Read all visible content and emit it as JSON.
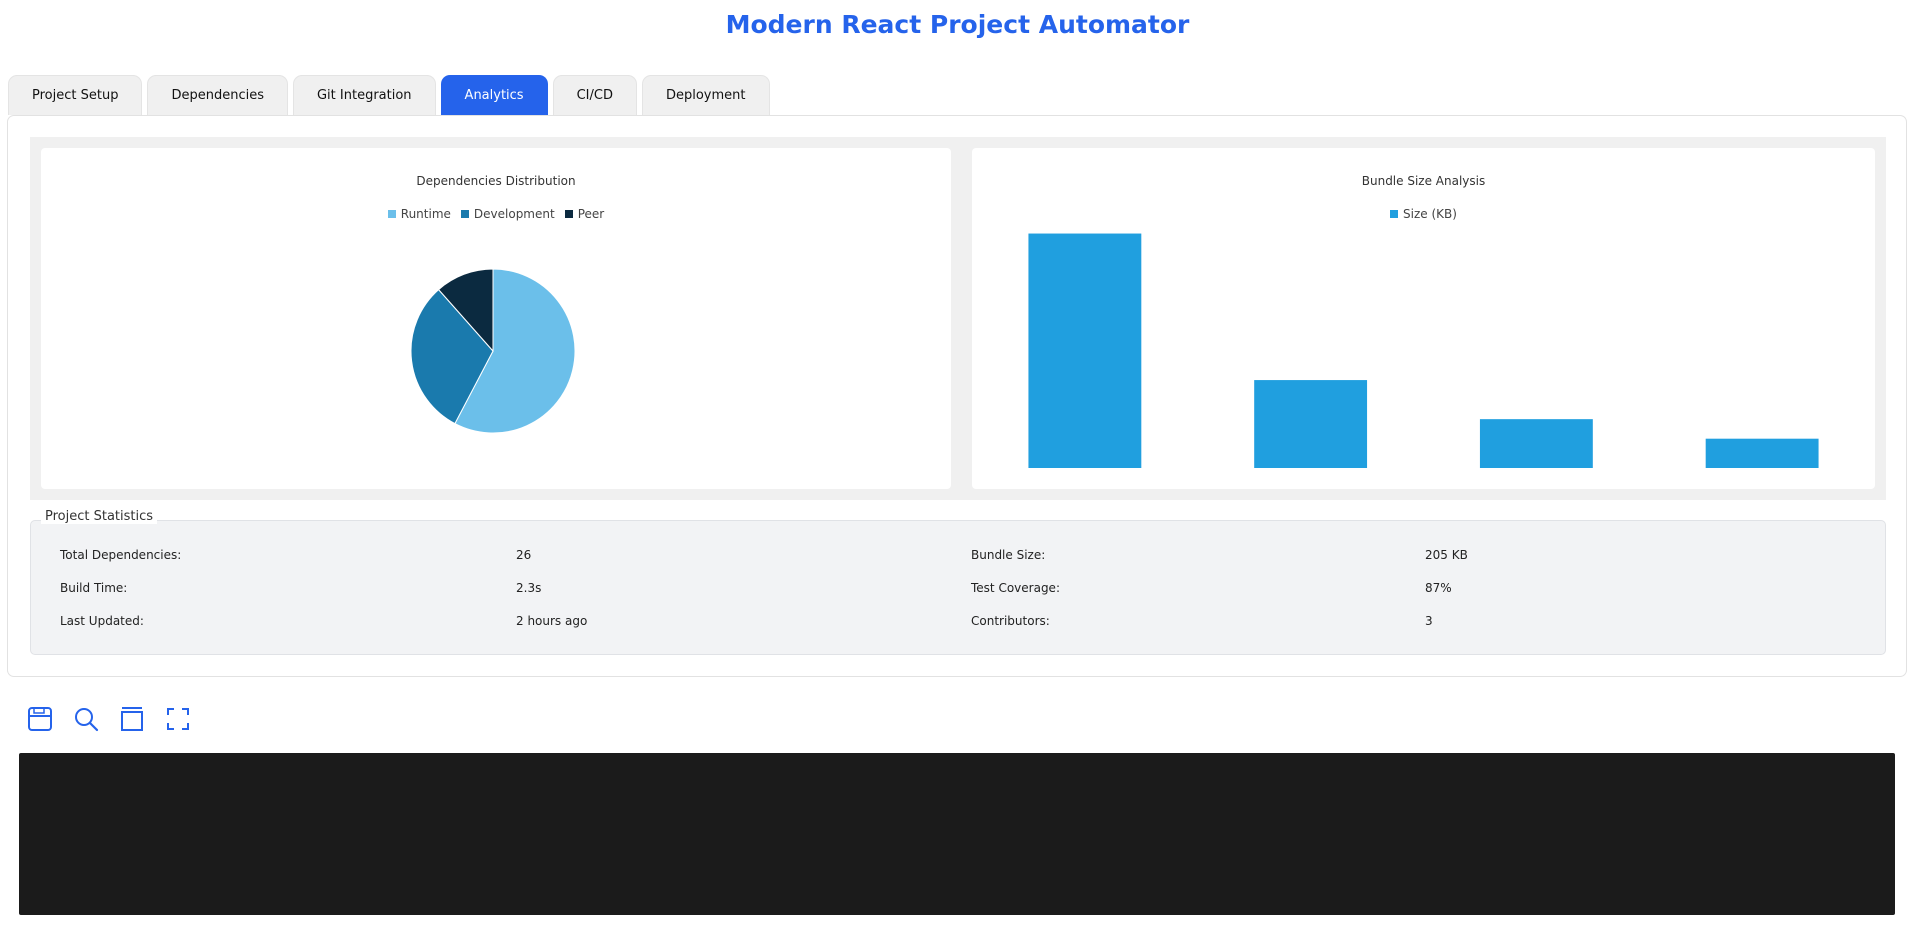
{
  "app": {
    "title": "Modern React Project Automator"
  },
  "tabs": [
    {
      "label": "Project Setup",
      "active": false
    },
    {
      "label": "Dependencies",
      "active": false
    },
    {
      "label": "Git Integration",
      "active": false
    },
    {
      "label": "Analytics",
      "active": true
    },
    {
      "label": "CI/CD",
      "active": false
    },
    {
      "label": "Deployment",
      "active": false
    }
  ],
  "colors": {
    "accent": "#2563eb",
    "runtime": "#6bbfea",
    "development": "#1a7aad",
    "peer": "#0b2a40",
    "bar": "#209fdf",
    "terminal": "#1b1b1b"
  },
  "charts": {
    "dependencies": {
      "title": "Dependencies Distribution"
    },
    "bundle": {
      "title": "Bundle Size Analysis"
    }
  },
  "chart_data": [
    {
      "type": "pie",
      "title": "Dependencies Distribution",
      "categories": [
        "Runtime",
        "Development",
        "Peer"
      ],
      "values": [
        15,
        8,
        3
      ],
      "legend": "top"
    },
    {
      "type": "bar",
      "title": "Bundle Size Analysis",
      "categories": [
        "",
        "",
        "",
        ""
      ],
      "series": [
        {
          "name": "Size (KB)",
          "values": [
            120,
            45,
            25,
            15
          ]
        }
      ],
      "ylim": [
        0,
        130
      ],
      "legend": "top"
    }
  ],
  "stats": {
    "legend": "Project Statistics",
    "items": [
      {
        "label": "Total Dependencies:",
        "value": "26"
      },
      {
        "label": "Bundle Size:",
        "value": "205 KB"
      },
      {
        "label": "Build Time:",
        "value": "2.3s"
      },
      {
        "label": "Test Coverage:",
        "value": "87%"
      },
      {
        "label": "Last Updated:",
        "value": "2 hours ago"
      },
      {
        "label": "Contributors:",
        "value": "3"
      }
    ]
  },
  "toolbar": {
    "icons": [
      "save-icon",
      "search-icon",
      "archive-icon",
      "fullscreen-icon"
    ]
  },
  "terminal": {
    "output": ""
  }
}
